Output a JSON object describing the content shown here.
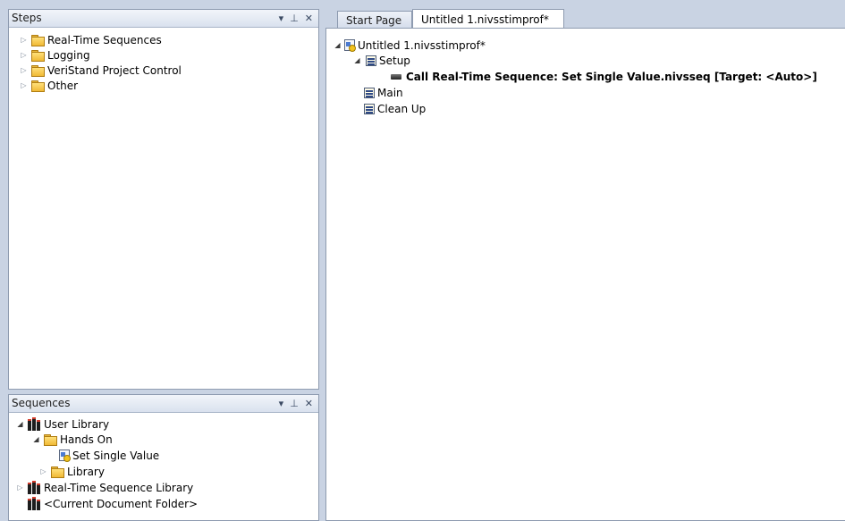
{
  "steps_panel": {
    "title": "Steps",
    "items": [
      {
        "label": "Real-Time Sequences"
      },
      {
        "label": "Logging"
      },
      {
        "label": "VeriStand Project Control"
      },
      {
        "label": "Other"
      }
    ]
  },
  "sequences_panel": {
    "title": "Sequences",
    "items": [
      {
        "label": "User Library"
      },
      {
        "label": "Hands On"
      },
      {
        "label": "Set Single Value"
      },
      {
        "label": "Library"
      },
      {
        "label": "Real-Time Sequence Library"
      },
      {
        "label": "<Current Document Folder>"
      }
    ]
  },
  "panel_tools": {
    "dropdown": "▾",
    "pin": "⊥",
    "close": "✕"
  },
  "tabs": [
    {
      "label": "Start Page",
      "active": false
    },
    {
      "label": "Untitled 1.nivsstimprof*",
      "active": true
    }
  ],
  "document_tree": {
    "root": "Untitled 1.nivsstimprof*",
    "setup": "Setup",
    "call_step": "Call Real-Time Sequence: Set Single Value.nivsseq [Target: <Auto>]",
    "main": "Main",
    "cleanup": "Clean Up"
  },
  "colors": {
    "background": "#c9d3e3",
    "panel_border": "#8e9bb0",
    "folder": "#f0b935"
  }
}
